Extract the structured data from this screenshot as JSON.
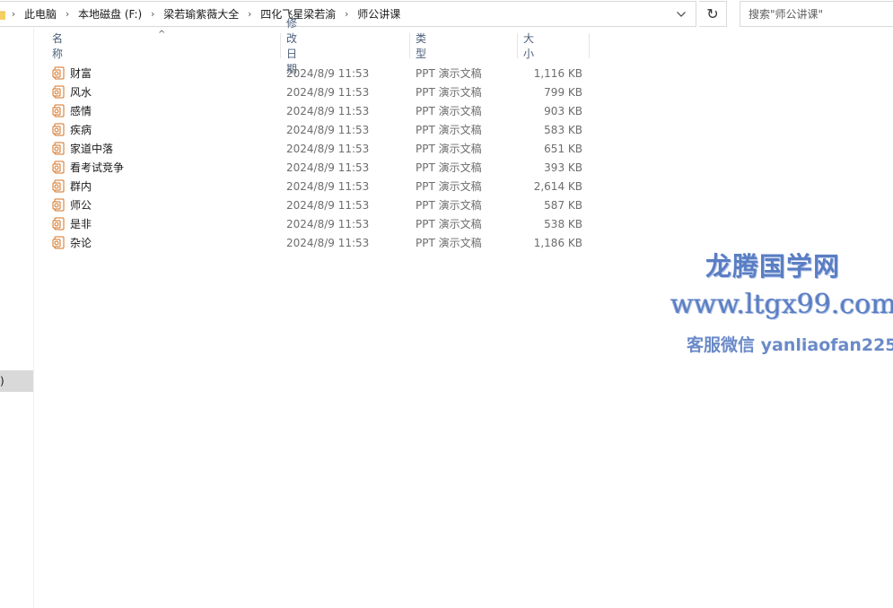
{
  "address_bar": {
    "breadcrumbs": [
      "此电脑",
      "本地磁盘 (F:)",
      "梁若瑜紫薇大全",
      "四化飞星梁若渝",
      "师公讲课"
    ]
  },
  "search": {
    "placeholder": "搜索\"师公讲课\""
  },
  "nav": {
    "selected_fragment": ")"
  },
  "columns": {
    "name": "名称",
    "date": "修改日期",
    "type": "类型",
    "size": "大小"
  },
  "files": [
    {
      "name": "财富",
      "date": "2024/8/9 11:53",
      "type": "PPT 演示文稿",
      "size": "1,116 KB"
    },
    {
      "name": "风水",
      "date": "2024/8/9 11:53",
      "type": "PPT 演示文稿",
      "size": "799 KB"
    },
    {
      "name": "感情",
      "date": "2024/8/9 11:53",
      "type": "PPT 演示文稿",
      "size": "903 KB"
    },
    {
      "name": "疾病",
      "date": "2024/8/9 11:53",
      "type": "PPT 演示文稿",
      "size": "583 KB"
    },
    {
      "name": "家道中落",
      "date": "2024/8/9 11:53",
      "type": "PPT 演示文稿",
      "size": "651 KB"
    },
    {
      "name": "看考试竞争",
      "date": "2024/8/9 11:53",
      "type": "PPT 演示文稿",
      "size": "393 KB"
    },
    {
      "name": "群内",
      "date": "2024/8/9 11:53",
      "type": "PPT 演示文稿",
      "size": "2,614 KB"
    },
    {
      "name": "师公",
      "date": "2024/8/9 11:53",
      "type": "PPT 演示文稿",
      "size": "587 KB"
    },
    {
      "name": "是非",
      "date": "2024/8/9 11:53",
      "type": "PPT 演示文稿",
      "size": "538 KB"
    },
    {
      "name": "杂论",
      "date": "2024/8/9 11:53",
      "type": "PPT 演示文稿",
      "size": "1,186 KB"
    }
  ],
  "watermark": {
    "line1": "龙腾国学网",
    "line2": "www.ltgx99.com",
    "line3": "客服微信 yanliaofan225"
  },
  "colors": {
    "header_text": "#4c607a",
    "watermark": "#5a7ec4",
    "ppt_icon": "#d4711f",
    "folder_icon": "#e8b84a"
  },
  "icons": {
    "folder": "folder-icon",
    "chevron": "chevron-right-icon",
    "dropdown": "chevron-down-icon",
    "refresh": "refresh-icon",
    "file": "ppt-file-icon",
    "sort": "sort-ascending-icon"
  }
}
